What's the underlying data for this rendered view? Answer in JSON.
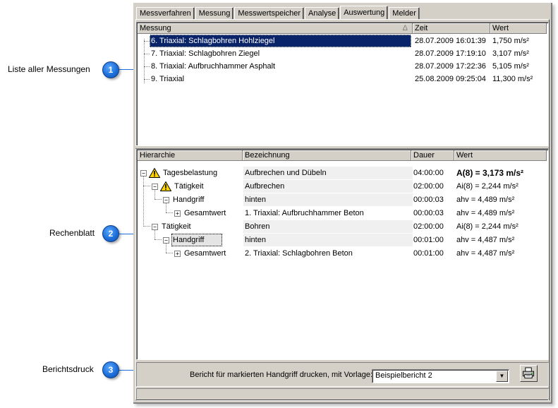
{
  "callouts": [
    {
      "label": "Liste aller Messungen",
      "number": "1"
    },
    {
      "label": "Rechenblatt",
      "number": "2"
    },
    {
      "label": "Berichtsdruck",
      "number": "3"
    }
  ],
  "tabs": [
    {
      "label": "Messverfahren",
      "active": false
    },
    {
      "label": "Messung",
      "active": false
    },
    {
      "label": "Messwertspeicher",
      "active": false
    },
    {
      "label": "Analyse",
      "active": false
    },
    {
      "label": "Auswertung",
      "active": true
    },
    {
      "label": "Melder",
      "active": false
    }
  ],
  "measurements": {
    "columns": [
      "Messung",
      "Zeit",
      "Wert"
    ],
    "sort_indicator": "Δ",
    "rows": [
      {
        "name": "6. Triaxial: Schlagbohren Hohlziegel",
        "time": "28.07.2009 16:01:39",
        "value": "1,750 m/s²",
        "selected": true
      },
      {
        "name": "7. Triaxial: Schlagbohren Ziegel",
        "time": "28.07.2009 17:19:10",
        "value": "3,107 m/s²",
        "selected": false
      },
      {
        "name": "8. Triaxial: Aufbruchhammer Asphalt",
        "time": "28.07.2009 17:22:36",
        "value": "5,105 m/s²",
        "selected": false
      },
      {
        "name": "9. Triaxial",
        "time": "25.08.2009 09:25:04",
        "value": "11,300 m/s²",
        "selected": false
      }
    ]
  },
  "worksheet": {
    "columns": [
      "Hierarchie",
      "Bezeichnung",
      "Dauer",
      "Wert"
    ],
    "rows": [
      {
        "hier": "Tagesbelastung",
        "desc": "Aufbrechen und Dübeln",
        "dur": "04:00:00",
        "val": "A(8) = 3,173 m/s²"
      },
      {
        "hier": "Tätigkeit",
        "desc": "Aufbrechen",
        "dur": "02:00:00",
        "val": "Ai(8) = 2,244 m/s²"
      },
      {
        "hier": "Handgriff",
        "desc": "hinten",
        "dur": "00:00:03",
        "val": "ahv = 4,489 m/s²"
      },
      {
        "hier": "Gesamtwert",
        "desc": "1. Triaxial: Aufbruchhammer Beton",
        "dur": "00:00:03",
        "val": "ahv = 4,489 m/s²"
      },
      {
        "hier": "Tätigkeit",
        "desc": "Bohren",
        "dur": "02:00:00",
        "val": "Ai(8) = 2,244 m/s²"
      },
      {
        "hier": "Handgriff",
        "desc": "hinten",
        "dur": "00:01:00",
        "val": "ahv = 4,487 m/s²"
      },
      {
        "hier": "Gesamtwert",
        "desc": "2. Triaxial: Schlagbohren Beton",
        "dur": "00:01:00",
        "val": "ahv = 4,487 m/s²"
      }
    ],
    "expander_minus": "−",
    "expander_plus": "+"
  },
  "report": {
    "label": "Bericht für markierten Handgriff drucken, mit Vorlage:",
    "template_value": "Beispielbericht 2",
    "dropdown_glyph": "▼"
  },
  "icons": {
    "warning": "warning-triangle-icon",
    "printer": "printer-icon"
  }
}
